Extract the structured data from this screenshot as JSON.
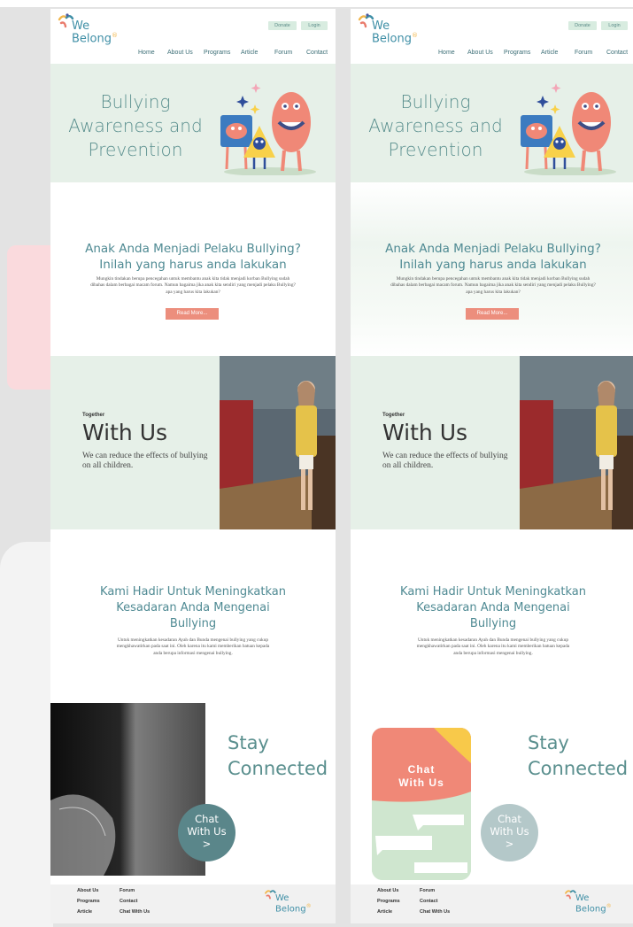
{
  "brand": {
    "line1": "We",
    "line2": "Belong",
    "mark": "®"
  },
  "header": {
    "donate_label": "Donate",
    "login_label": "Login"
  },
  "nav": [
    "Home",
    "About Us",
    "Programs",
    "Article",
    "Forum",
    "Contact"
  ],
  "hero": {
    "title": "Bullying Awareness and Prevention"
  },
  "article": {
    "title": "Anak Anda Menjadi Pelaku Bullying? Inilah yang harus anda lakukan",
    "body": "Mungkin tindakan berupa pencegahan untuk membantu anak kita tidak menjadi korban Bullying sudah dibahas dalam berbagai macam forum. Namun bagaima jika anak kita sendiri yang menjadi pelaku Bullying? apa yang harus kita lakukan?",
    "button": "Read More..."
  },
  "together": {
    "kicker": "Together",
    "title": "With Us",
    "text": "We can reduce the effects of bullying on all children."
  },
  "mission": {
    "title": "Kami Hadir Untuk Meningkatkan Kesadaran Anda Mengenai Bullying",
    "body": "Untuk meningkatkan kesadaran Ayah dan Bunda mengenai bullying yang cukup mengkhawatirkan pada saat ini. Oleh karena itu kami memberikan batuan kepada anda berupa informasi mengenai bullying."
  },
  "connect": {
    "title": "Stay Connected",
    "chat_line1": "Chat",
    "chat_line2": "With Us",
    "chat_arrow": ">",
    "phone_title_1": "Chat",
    "phone_title_2": "With Us"
  },
  "footer": {
    "col1": [
      "About Us",
      "Programs",
      "Article"
    ],
    "col2": [
      "Forum",
      "Contact",
      "Chat With Us"
    ]
  },
  "colors": {
    "accent_teal": "#5a8f8e",
    "mint_bg": "#e6f0e8",
    "coral": "#ec8e7d",
    "yellow": "#f8d14a"
  }
}
